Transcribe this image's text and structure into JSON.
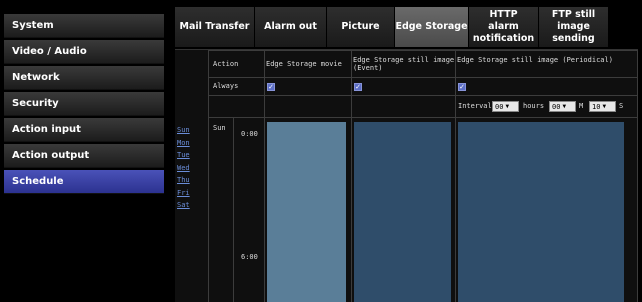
{
  "sidebar": {
    "items": [
      {
        "label": "System"
      },
      {
        "label": "Video / Audio"
      },
      {
        "label": "Network"
      },
      {
        "label": "Security"
      },
      {
        "label": "Action input"
      },
      {
        "label": "Action output"
      },
      {
        "label": "Schedule",
        "active": true
      }
    ]
  },
  "tabs": [
    {
      "label": "Mail Transfer"
    },
    {
      "label": "Alarm out"
    },
    {
      "label": "Picture"
    },
    {
      "label": "Edge Storage",
      "active": true
    },
    {
      "label": "HTTP alarm notification"
    },
    {
      "label": "FTP still image sending"
    }
  ],
  "table": {
    "action_header": "Action",
    "always_label": "Always",
    "col_movie": "Edge Storage movie",
    "col_event": "Edge Storage still image (Event)",
    "col_periodic": "Edge Storage still image (Periodical)",
    "interval_label": "Interval",
    "hours_value": "00",
    "hours_label": "hours",
    "minutes_value": "00",
    "minutes_label": "M",
    "seconds_value": "10",
    "seconds_label": "S"
  },
  "days": [
    "Sun",
    "Mon",
    "Tue",
    "Wed",
    "Thu",
    "Fri",
    "Sat"
  ],
  "schedule": {
    "current_day": "Sun",
    "time_0": "0:00",
    "time_6": "6:00"
  },
  "colors": {
    "active_sidebar": "#3a41a8",
    "link": "#6a8dd8",
    "movie_bar": "#5a7e98",
    "still_bar": "#2f4d6a",
    "checkbox": "#5d6fc7"
  }
}
